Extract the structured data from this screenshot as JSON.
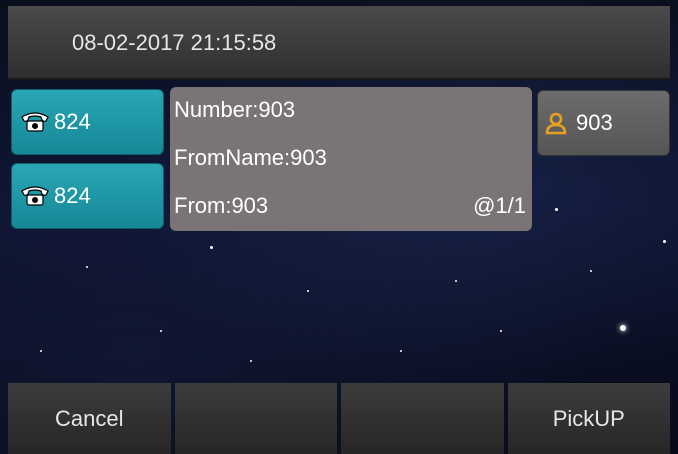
{
  "status_bar": {
    "datetime": "08-02-2017 21:15:58"
  },
  "line_keys": [
    {
      "label": "824",
      "icon": "phone-icon"
    },
    {
      "label": "824",
      "icon": "phone-icon"
    }
  ],
  "call_info": {
    "number_line": "Number:903",
    "fromname_line": "FromName:903",
    "from_line": "From:903",
    "page_indicator": "@1/1"
  },
  "contact_key": {
    "label": "903",
    "icon": "person-icon",
    "icon_color": "#e8a020"
  },
  "softkeys": [
    "Cancel",
    "",
    "",
    "PickUP"
  ],
  "colors": {
    "line_key": "#1e97a5",
    "info_panel": "#7a7474",
    "softkey": "#333333"
  }
}
